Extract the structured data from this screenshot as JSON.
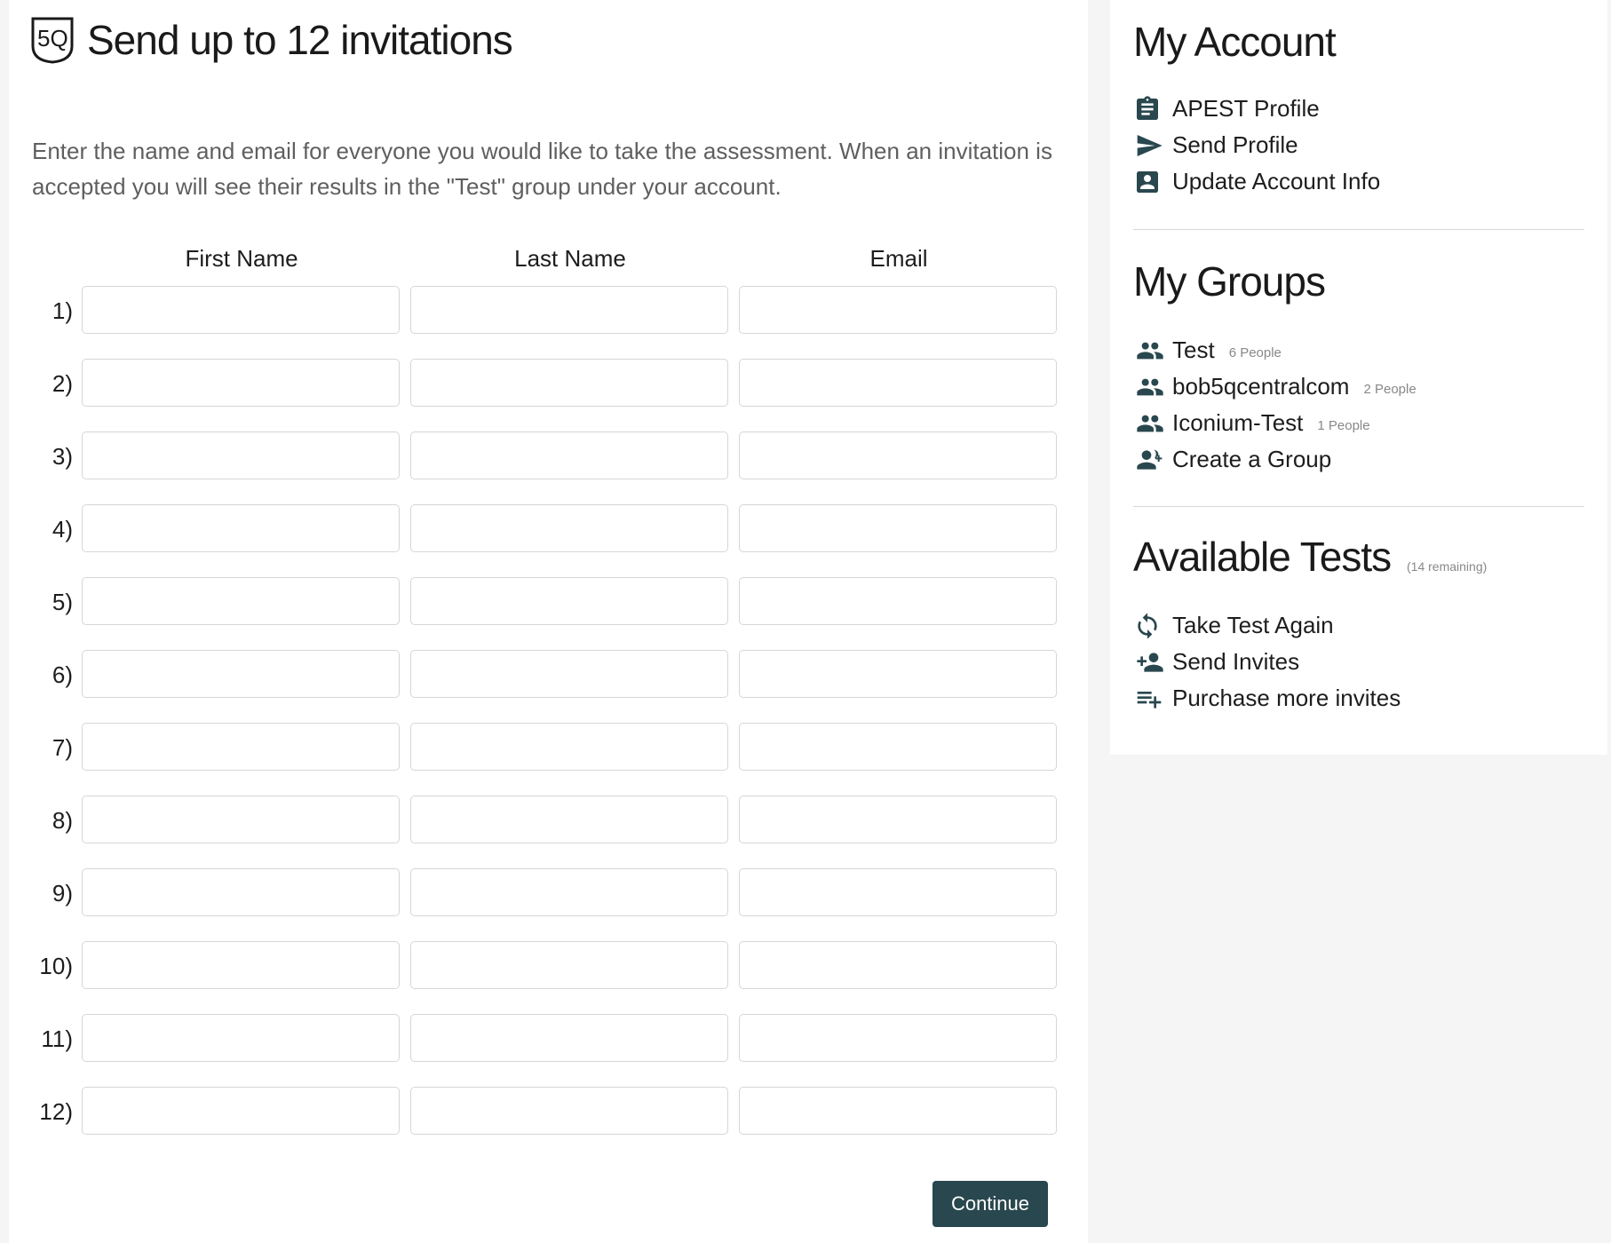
{
  "main": {
    "title": "Send up to 12 invitations",
    "intro": "Enter the name and email for everyone you would like to take the assessment. When an invitation is accepted you will see their results in the \"Test\" group under your account.",
    "columns": {
      "first_name": "First Name",
      "last_name": "Last Name",
      "email": "Email"
    },
    "rows": [
      "1)",
      "2)",
      "3)",
      "4)",
      "5)",
      "6)",
      "7)",
      "8)",
      "9)",
      "10)",
      "11)",
      "12)"
    ],
    "continue_label": "Continue"
  },
  "sidebar": {
    "account": {
      "heading": "My Account",
      "items": [
        {
          "label": "APEST Profile",
          "icon": "clipboard-icon"
        },
        {
          "label": "Send Profile",
          "icon": "send-icon"
        },
        {
          "label": "Update Account Info",
          "icon": "account-box-icon"
        }
      ]
    },
    "groups": {
      "heading": "My Groups",
      "items": [
        {
          "label": "Test",
          "count": "6 People",
          "icon": "people-icon"
        },
        {
          "label": "bob5qcentralcom",
          "count": "2 People",
          "icon": "people-icon"
        },
        {
          "label": "Iconium-Test",
          "count": "1 People",
          "icon": "people-icon"
        },
        {
          "label": "Create a Group",
          "icon": "group-add-icon"
        }
      ]
    },
    "tests": {
      "heading": "Available Tests",
      "remaining": "(14 remaining)",
      "items": [
        {
          "label": "Take Test Again",
          "icon": "refresh-icon"
        },
        {
          "label": "Send Invites",
          "icon": "person-add-icon"
        },
        {
          "label": "Purchase more invites",
          "icon": "playlist-add-icon"
        }
      ]
    }
  },
  "colors": {
    "primary_button": "#29474e",
    "icon": "#29474e",
    "muted_text": "#5f5f5f",
    "background": "#f5f5f5"
  }
}
